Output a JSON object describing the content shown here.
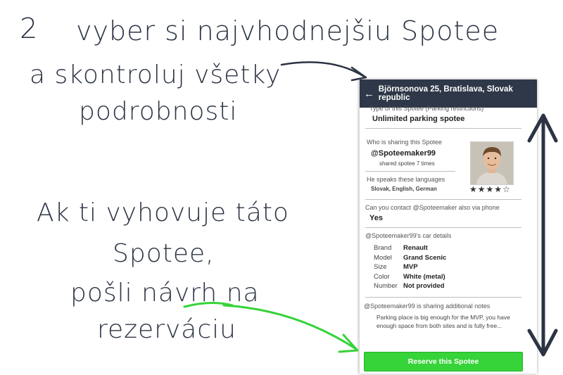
{
  "annotations": {
    "step_number": "2",
    "top_line1": "vyber si najvhodnejšiu Spotee",
    "top_line2": "a skontroluj všetky",
    "top_line3": "podrobnosti",
    "bottom_line1": "Ak ti vyhovuje táto",
    "bottom_line2": "Spotee,",
    "bottom_line3": "pošli návrh na",
    "bottom_line4": "rezerváciu",
    "colors": {
      "handwriting": "#2c3444",
      "highlight": "#36d339",
      "arrow": "#2e3848"
    }
  },
  "app": {
    "header": {
      "back_icon": "←",
      "title": "Björnsonova 25, Bratislava, Slovak republic"
    },
    "spotee_type": {
      "label": "Type of this Spotee (Parking restrictions)",
      "value": "Unlimited parking spotee"
    },
    "sharer": {
      "label": "Who is sharing this Spotee",
      "username": "@Spoteemaker99",
      "shared_count": "shared spotee 7 times",
      "avatar_icon": "user-photo",
      "rating": "★★★★☆"
    },
    "languages": {
      "label": "He speaks these languages",
      "value": "Slovak, English, German"
    },
    "phone_contact": {
      "label": "Can you contact @Spoteemaker also via phone",
      "value": "Yes"
    },
    "car": {
      "title": "@Spoteemaker99's car details",
      "rows": [
        {
          "key": "Brand",
          "value": "Renault"
        },
        {
          "key": "Model",
          "value": "Grand Scenic"
        },
        {
          "key": "Size",
          "value": "MVP"
        },
        {
          "key": "Color",
          "value": "White (metal)"
        },
        {
          "key": "Number",
          "value": "Not provided"
        }
      ]
    },
    "notes": {
      "title": "@Spoteemaker99 is sharing additional notes",
      "text": "Parking place is big enough for the MVP, you have enough space from both sites and is fully free..."
    },
    "reserve_button": "Reserve this Spotee",
    "accent": "#36d339",
    "header_color": "#2e3848"
  }
}
